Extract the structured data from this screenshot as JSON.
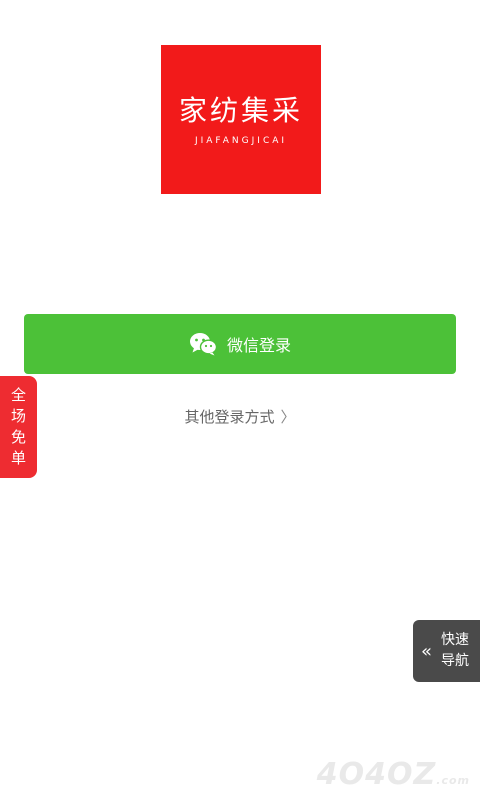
{
  "logo": {
    "name_cn": "家纺集采",
    "name_en": "JIAFANGJICAI",
    "background": "#f21a1a"
  },
  "wechat_login": {
    "label": "微信登录",
    "icon": "wechat-icon",
    "background": "#4cc138"
  },
  "other_login": {
    "label": "其他登录方式",
    "chevron": "〉"
  },
  "free_badge": {
    "lines": [
      "全",
      "场",
      "免",
      "单"
    ],
    "background": "#ee2c31"
  },
  "quick_nav": {
    "arrows": "«",
    "lines": [
      "快速",
      "导航"
    ],
    "background": "#4a4a4a"
  },
  "watermark": {
    "text": "4O4OZ",
    "suffix": ".com"
  }
}
